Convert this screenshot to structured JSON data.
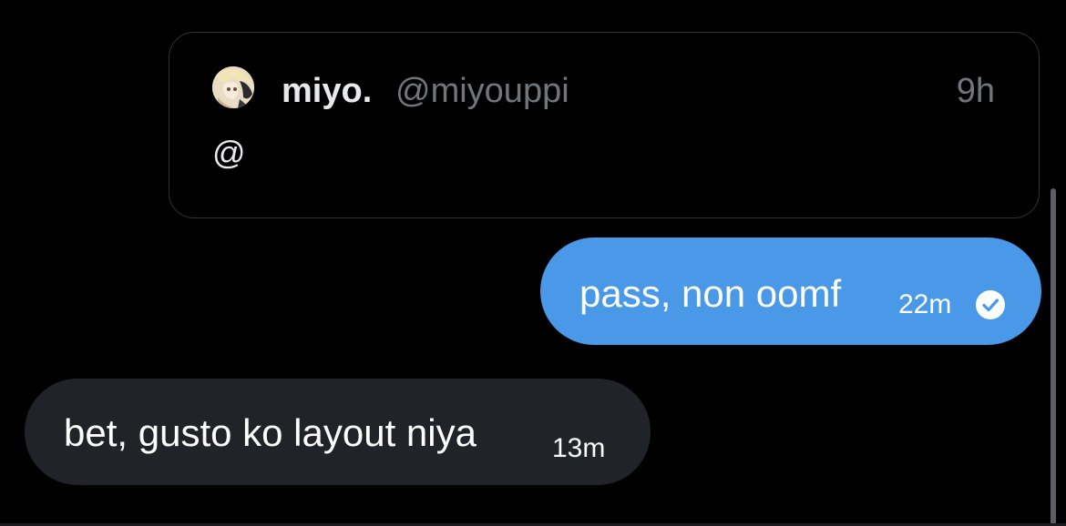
{
  "quoted_post": {
    "author_name": "miyo.",
    "author_handle": "@miyouppi",
    "time": "9h",
    "text": "@"
  },
  "messages": [
    {
      "direction": "sent",
      "text": "pass, non oomf",
      "time": "22m",
      "status_icon": "read-check-icon"
    },
    {
      "direction": "received",
      "text": "bet, gusto ko layout niya",
      "time": "13m"
    }
  ],
  "colors": {
    "background": "#000000",
    "sent_bubble": "#4a99e9",
    "received_bubble": "#202327",
    "card_border": "#2f3336",
    "muted_text": "#71767b"
  }
}
